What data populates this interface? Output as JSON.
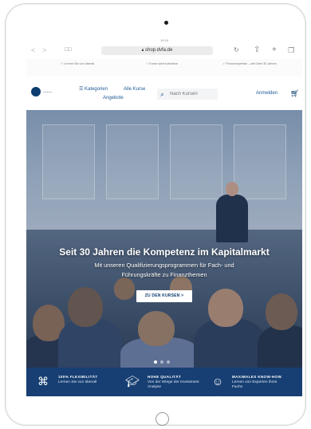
{
  "device": {
    "status_time": "10:15"
  },
  "browser": {
    "back": "<",
    "forward": ">",
    "bookmarks_glyph": "□□",
    "url": "shop.dvfa.de",
    "reload_glyph": "↻",
    "share_glyph": "⇧",
    "new_tab_glyph": "+",
    "tabs_glyph": "❐"
  },
  "usp_bar": [
    {
      "text": "Lernen Sie von überall"
    },
    {
      "text": "Kurse sofort abrufbar"
    },
    {
      "text": "Finanzexpertise – seit über 30 Jahren"
    }
  ],
  "header": {
    "nav_categories": "Kategorien",
    "nav_all": "Alle Kurse",
    "nav_offers": "Angebote",
    "search_placeholder": "Nach Kursen",
    "login": "Anmelden"
  },
  "hero": {
    "headline": "Seit 30 Jahren die Kompetenz im Kapitalmarkt",
    "subline": "Mit unseren Qualifizierungsprogrammen für Fach- und Führungskräfte zu Finanzthemen",
    "cta": "ZU DEN KURSEN >",
    "slides": 3,
    "active_slide": 1
  },
  "features": [
    {
      "icon": "flexibility-icon",
      "title": "100% FLEXIBILITÄT",
      "text": "Lernen Sie von überall"
    },
    {
      "icon": "graduation-cap-icon",
      "title": "HOHE QUALITÄT",
      "text": "Von der Wiege der Investment Analyse"
    },
    {
      "icon": "experts-icon",
      "title": "MAXIMALES KNOW-HOW",
      "text": "Lernen von Experten ihres Fachs"
    }
  ],
  "colors": {
    "brand_blue": "#173f73",
    "link_blue": "#1f5a98",
    "bg": "#ffffff"
  }
}
